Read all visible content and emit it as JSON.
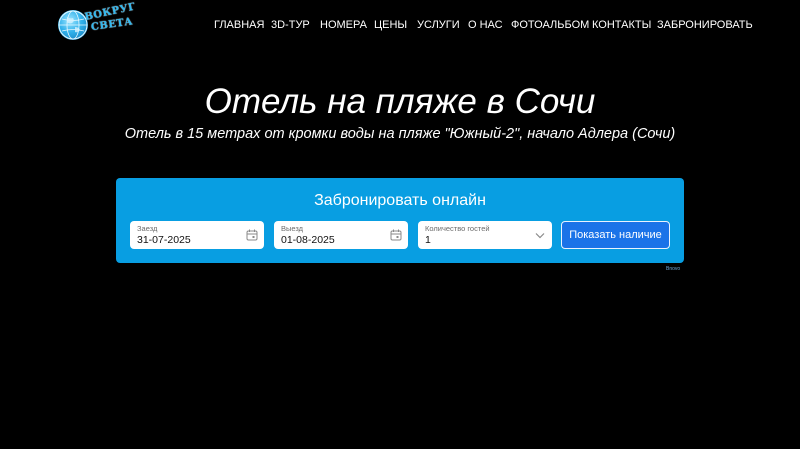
{
  "header": {
    "logo_text_line1": "ВОКРУГ",
    "logo_text_line2": "СВЕТА",
    "nav": [
      {
        "label": "ГЛАВНАЯ"
      },
      {
        "label": "3D-ТУР"
      },
      {
        "label": "НОМЕРА"
      },
      {
        "label": "ЦЕНЫ"
      },
      {
        "label": "УСЛУГИ"
      },
      {
        "label": "О НАС"
      },
      {
        "label": "ФОТОАЛЬБОМ"
      },
      {
        "label": "КОНТАКТЫ"
      },
      {
        "label": "ЗАБРОНИРОВАТЬ"
      }
    ]
  },
  "hero": {
    "title": "Отель на пляже в Сочи",
    "subtitle": "Отель в 15 метрах от кромки воды на пляже \"Южный-2\", начало Адлера (Сочи)"
  },
  "booking": {
    "title": "Забронировать онлайн",
    "checkin": {
      "label": "Заезд",
      "value": "31-07-2025",
      "icon": "calendar-icon"
    },
    "checkout": {
      "label": "Выезд",
      "value": "01-08-2025",
      "icon": "calendar-icon"
    },
    "guests": {
      "label": "Количество гостей",
      "value": "1",
      "icon": "chevron-down-icon"
    },
    "submit_label": "Показать наличие",
    "credit": "Bnovo"
  },
  "colors": {
    "background": "#000000",
    "booking_panel": "#089ee2",
    "button": "#1a73e8",
    "logo": "#2fb8f0"
  }
}
